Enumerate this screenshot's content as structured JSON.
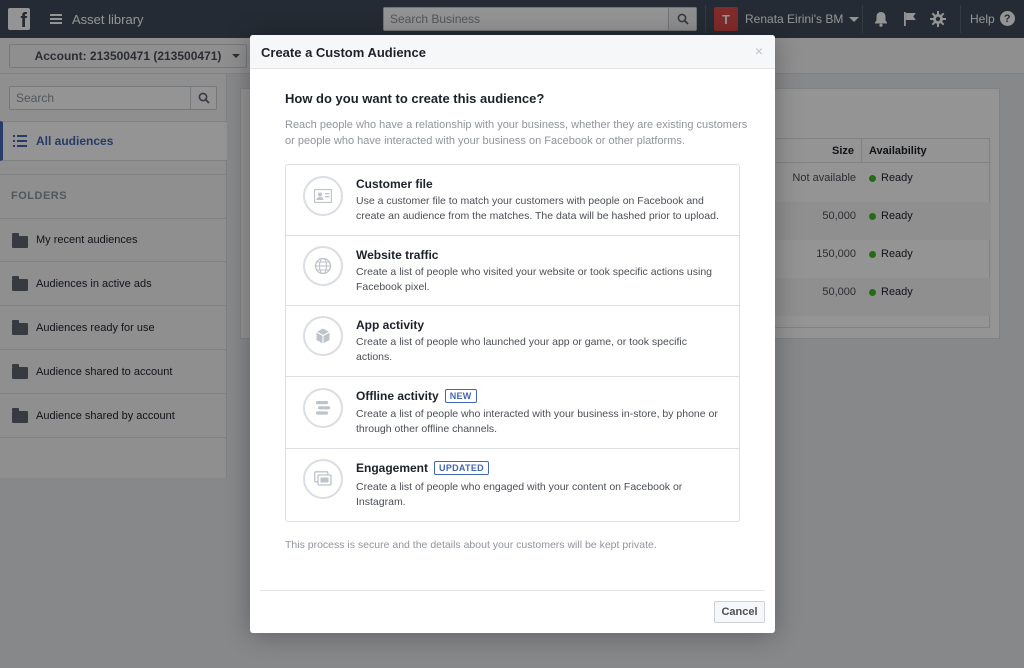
{
  "topbar": {
    "logo_letter": "f",
    "app_title": "Asset library",
    "search_placeholder": "Search Business",
    "business_avatar": "T",
    "business_name": "Renata Eirini's BM",
    "help_label": "Help",
    "help_glyph": "?"
  },
  "account": {
    "label": "Account: 213500471 (213500471)"
  },
  "sidebar": {
    "search_placeholder": "Search",
    "all_audiences": "All audiences",
    "folders_title": "FOLDERS",
    "folders": [
      "My recent audiences",
      "Audiences in active ads",
      "Audiences ready for use",
      "Audience shared to account",
      "Audience shared by account"
    ]
  },
  "table": {
    "headers": {
      "size": "Size",
      "availability": "Availability"
    },
    "rows": [
      {
        "size": "Not available",
        "availability": "Ready"
      },
      {
        "size": "50,000",
        "availability": "Ready"
      },
      {
        "size": "150,000",
        "availability": "Ready"
      },
      {
        "size": "50,000",
        "availability": "Ready"
      }
    ],
    "ready_color": "#42b72a"
  },
  "modal": {
    "title": "Create a Custom Audience",
    "close_glyph": "×",
    "question": "How do you want to create this audience?",
    "intro": "Reach people who have a relationship with your business, whether they are existing customers or people who have interacted with your business on Facebook or other platforms.",
    "options": [
      {
        "title": "Customer file",
        "badge": "",
        "description": "Use a customer file to match your customers with people on Facebook and create an audience from the matches. The data will be hashed prior to upload.",
        "icon": "contact-card-icon"
      },
      {
        "title": "Website traffic",
        "badge": "",
        "description": "Create a list of people who visited your website or took specific actions using Facebook pixel.",
        "icon": "globe-icon"
      },
      {
        "title": "App activity",
        "badge": "",
        "description": "Create a list of people who launched your app or game, or took specific actions.",
        "icon": "cube-icon"
      },
      {
        "title": "Offline activity",
        "badge": "NEW",
        "description": "Create a list of people who interacted with your business in-store, by phone or through other offline channels.",
        "icon": "offline-stack-icon"
      },
      {
        "title": "Engagement",
        "badge": "UPDATED",
        "description": "Create a list of people who engaged with your content on Facebook or Instagram.",
        "icon": "engagement-icon"
      }
    ],
    "secure_note": "This process is secure and the details about your customers will be kept private.",
    "cancel_label": "Cancel"
  },
  "colors": {
    "topbar": "#404a5b",
    "accent": "#4267b2",
    "avatar": "#e04a4a"
  }
}
